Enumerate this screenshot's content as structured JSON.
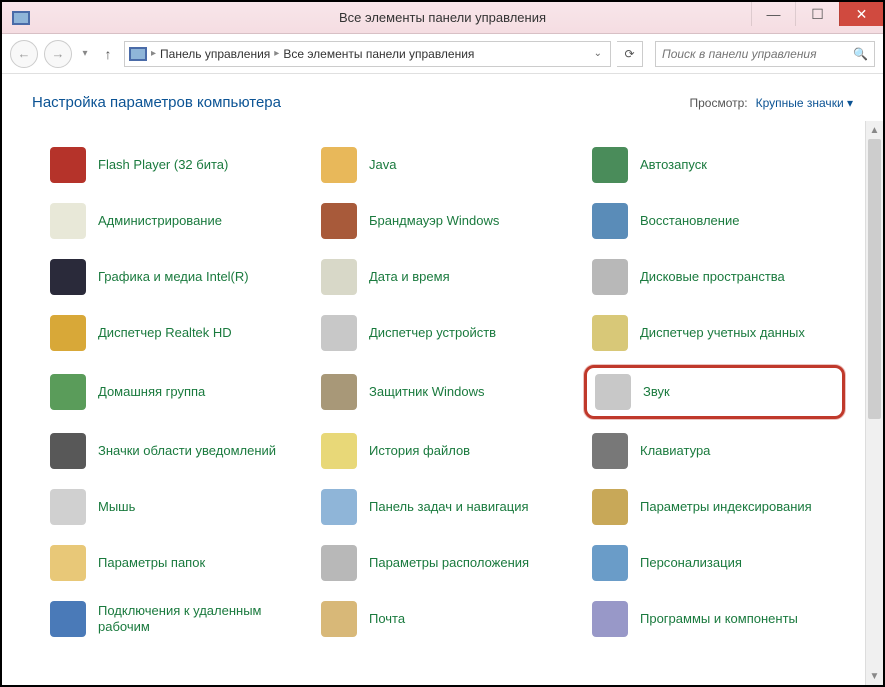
{
  "window": {
    "title": "Все элементы панели управления"
  },
  "breadcrumb": {
    "root": "Панель управления",
    "current": "Все элементы панели управления"
  },
  "search": {
    "placeholder": "Поиск в панели управления"
  },
  "header": {
    "title": "Настройка параметров компьютера",
    "view_label": "Просмотр:",
    "view_value": "Крупные значки"
  },
  "items": [
    {
      "label": "Flash Player (32 бита)",
      "icon": "ic-flash",
      "name": "flash-player"
    },
    {
      "label": "Java",
      "icon": "ic-java",
      "name": "java"
    },
    {
      "label": "Автозапуск",
      "icon": "ic-auto",
      "name": "autorun"
    },
    {
      "label": "Администрирование",
      "icon": "ic-admin",
      "name": "admin-tools"
    },
    {
      "label": "Брандмауэр Windows",
      "icon": "ic-fw",
      "name": "firewall"
    },
    {
      "label": "Восстановление",
      "icon": "ic-rest",
      "name": "recovery"
    },
    {
      "label": "Графика и медиа Intel(R)",
      "icon": "ic-intel",
      "name": "intel-graphics"
    },
    {
      "label": "Дата и время",
      "icon": "ic-date",
      "name": "date-time"
    },
    {
      "label": "Дисковые пространства",
      "icon": "ic-disk",
      "name": "storage-spaces"
    },
    {
      "label": "Диспетчер Realtek HD",
      "icon": "ic-realtek",
      "name": "realtek"
    },
    {
      "label": "Диспетчер устройств",
      "icon": "ic-devmgr",
      "name": "device-manager"
    },
    {
      "label": "Диспетчер учетных данных",
      "icon": "ic-cred",
      "name": "credential-manager"
    },
    {
      "label": "Домашняя группа",
      "icon": "ic-home",
      "name": "homegroup"
    },
    {
      "label": "Защитник Windows",
      "icon": "ic-def",
      "name": "defender"
    },
    {
      "label": "Звук",
      "icon": "ic-sound",
      "name": "sound",
      "highlight": true
    },
    {
      "label": "Значки области уведомлений",
      "icon": "ic-tray",
      "name": "notification-icons"
    },
    {
      "label": "История файлов",
      "icon": "ic-hist",
      "name": "file-history"
    },
    {
      "label": "Клавиатура",
      "icon": "ic-kb",
      "name": "keyboard"
    },
    {
      "label": "Мышь",
      "icon": "ic-mouse",
      "name": "mouse"
    },
    {
      "label": "Панель задач и навигация",
      "icon": "ic-task",
      "name": "taskbar"
    },
    {
      "label": "Параметры индексирования",
      "icon": "ic-index",
      "name": "indexing"
    },
    {
      "label": "Параметры папок",
      "icon": "ic-folder",
      "name": "folder-options"
    },
    {
      "label": "Параметры расположения",
      "icon": "ic-loc",
      "name": "location"
    },
    {
      "label": "Персонализация",
      "icon": "ic-pers",
      "name": "personalization"
    },
    {
      "label": "Подключения к удаленным рабочим",
      "icon": "ic-remote",
      "name": "remote-app"
    },
    {
      "label": "Почта",
      "icon": "ic-mail",
      "name": "mail"
    },
    {
      "label": "Программы и компоненты",
      "icon": "ic-prog",
      "name": "programs"
    }
  ]
}
